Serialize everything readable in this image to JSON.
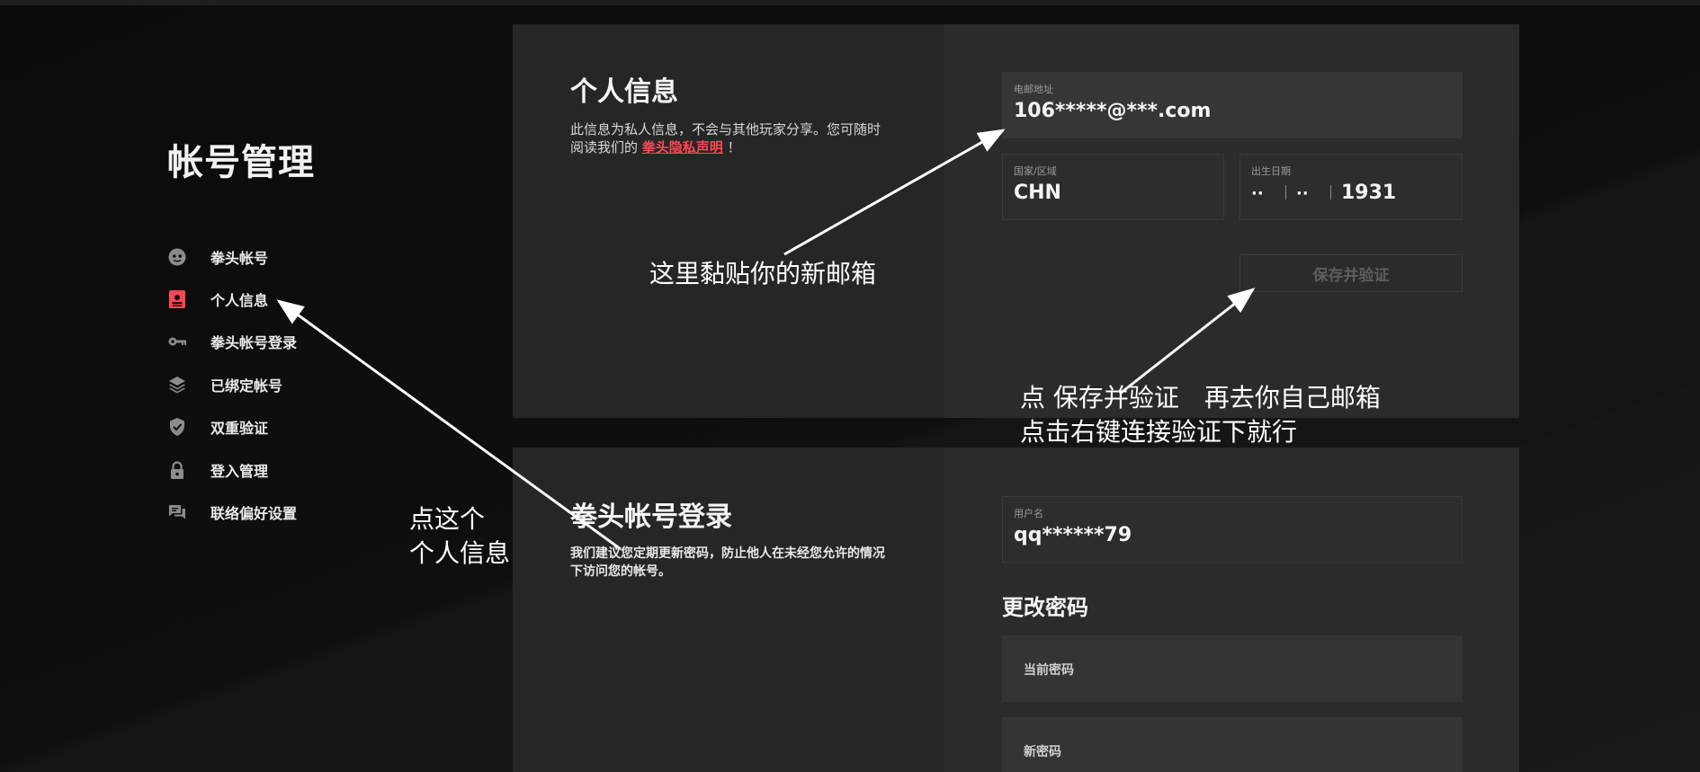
{
  "sidebar": {
    "title": "帐号管理",
    "items": [
      {
        "label": "拳头帐号",
        "icon": "riot-face-icon",
        "active": false
      },
      {
        "label": "个人信息",
        "icon": "id-badge-icon",
        "active": true
      },
      {
        "label": "拳头帐号登录",
        "icon": "key-icon",
        "active": false
      },
      {
        "label": "已绑定帐号",
        "icon": "layers-icon",
        "active": false
      },
      {
        "label": "双重验证",
        "icon": "shield-check-icon",
        "active": false
      },
      {
        "label": "登入管理",
        "icon": "lock-icon",
        "active": false
      },
      {
        "label": "联络偏好设置",
        "icon": "chat-icon",
        "active": false
      }
    ]
  },
  "personal_info": {
    "title": "个人信息",
    "desc_prefix": "此信息为私人信息，不会与其他玩家分享。您可随时阅读我们的",
    "privacy_link": "拳头隐私声明",
    "desc_suffix": "！",
    "email_label": "电邮地址",
    "email_value": "106*****@***.com",
    "country_label": "国家/区域",
    "country_value": "CHN",
    "dob_label": "出生日期",
    "dob_month": "··",
    "dob_day": "··",
    "dob_year": "1931",
    "save_button": "保存并验证"
  },
  "riot_login": {
    "title": "拳头帐号登录",
    "desc": "我们建议您定期更新密码，防止他人在未经您允许的情况下访问您的帐号。",
    "username_label": "用户名",
    "username_value": "qq******79",
    "change_password_title": "更改密码",
    "current_password_label": "当前密码",
    "new_password_label": "新密码"
  },
  "annotations": {
    "paste_email": "这里黏贴你的新邮箱",
    "click_save_line1": "点 保存并验证　再去你自己邮箱",
    "click_save_line2": "点击右键连接验证下就行",
    "click_this_line1": "点这个",
    "click_this_line2": "个人信息"
  },
  "colors": {
    "accent": "#ff4655",
    "background": "#0c0c0c",
    "panel_left": "#262626",
    "panel_right": "#2c2b2b"
  }
}
